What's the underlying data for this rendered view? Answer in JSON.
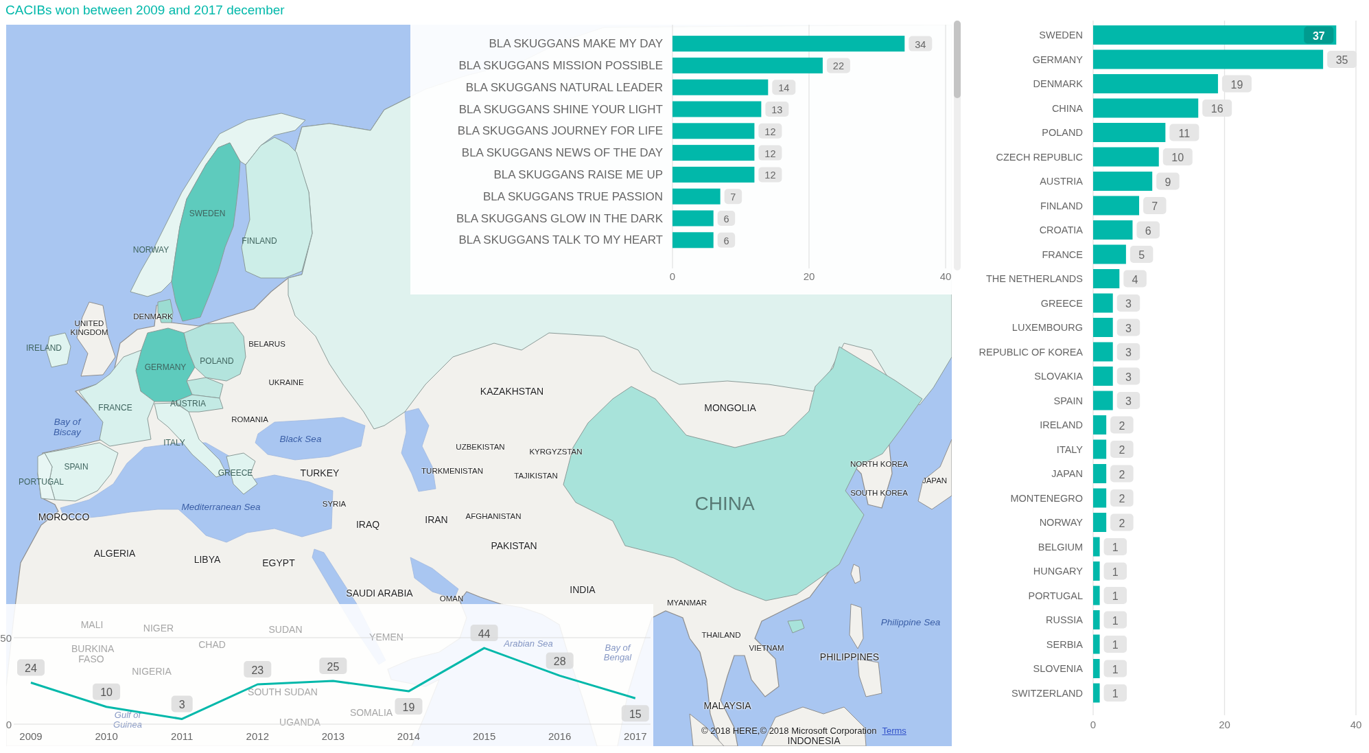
{
  "title": "CACIBs won between 2009 and 2017 december",
  "map": {
    "labels": [
      {
        "text": "SWEDEN",
        "kind": "shaded"
      },
      {
        "text": "FINLAND",
        "kind": "shaded"
      },
      {
        "text": "NORWAY",
        "kind": "shaded"
      },
      {
        "text": "DENMARK",
        "kind": "small"
      },
      {
        "text": "UNITED KINGDOM",
        "kind": "small"
      },
      {
        "text": "IRELAND",
        "kind": "shaded"
      },
      {
        "text": "BELARUS",
        "kind": "small"
      },
      {
        "text": "POLAND",
        "kind": "shaded"
      },
      {
        "text": "GERMANY",
        "kind": "shaded"
      },
      {
        "text": "UKRAINE",
        "kind": "small"
      },
      {
        "text": "KAZAKHSTAN",
        "kind": "country"
      },
      {
        "text": "FRANCE",
        "kind": "shaded"
      },
      {
        "text": "AUSTRIA",
        "kind": "shaded"
      },
      {
        "text": "MONGOLIA",
        "kind": "country"
      },
      {
        "text": "ROMANIA",
        "kind": "small"
      },
      {
        "text": "Bay of Biscay",
        "kind": "sea"
      },
      {
        "text": "ITALY",
        "kind": "shaded"
      },
      {
        "text": "Black Sea",
        "kind": "sea"
      },
      {
        "text": "UZBEKISTAN",
        "kind": "small"
      },
      {
        "text": "KYRGYZSTAN",
        "kind": "small"
      },
      {
        "text": "SPAIN",
        "kind": "shaded"
      },
      {
        "text": "NORTH KOREA",
        "kind": "small"
      },
      {
        "text": "GREECE",
        "kind": "shaded"
      },
      {
        "text": "TURKEY",
        "kind": "country"
      },
      {
        "text": "TURKMENISTAN",
        "kind": "small"
      },
      {
        "text": "TAJIKISTAN",
        "kind": "small"
      },
      {
        "text": "PORTUGAL",
        "kind": "shaded"
      },
      {
        "text": "JAPAN",
        "kind": "small"
      },
      {
        "text": "SOUTH KOREA",
        "kind": "small"
      },
      {
        "text": "Mediterranean Sea",
        "kind": "sea"
      },
      {
        "text": "SYRIA",
        "kind": "small"
      },
      {
        "text": "CHINA",
        "kind": "large"
      },
      {
        "text": "MOROCCO",
        "kind": "country"
      },
      {
        "text": "IRAQ",
        "kind": "country"
      },
      {
        "text": "IRAN",
        "kind": "country"
      },
      {
        "text": "AFGHANISTAN",
        "kind": "small"
      },
      {
        "text": "PAKISTAN",
        "kind": "country"
      },
      {
        "text": "ALGERIA",
        "kind": "country"
      },
      {
        "text": "LIBYA",
        "kind": "country"
      },
      {
        "text": "EGYPT",
        "kind": "country"
      },
      {
        "text": "SAUDI ARABIA",
        "kind": "country"
      },
      {
        "text": "INDIA",
        "kind": "country"
      },
      {
        "text": "OMAN",
        "kind": "small"
      },
      {
        "text": "MYANMAR",
        "kind": "small"
      },
      {
        "text": "Philippine Sea",
        "kind": "sea"
      },
      {
        "text": "THAILAND",
        "kind": "small"
      },
      {
        "text": "VIETNAM",
        "kind": "small"
      },
      {
        "text": "PHILIPPINES",
        "kind": "country"
      },
      {
        "text": "MALAYSIA",
        "kind": "country"
      },
      {
        "text": "INDONESIA",
        "kind": "country"
      }
    ],
    "labels_behind_year_chart": [
      {
        "text": "MALI",
        "kind": "country"
      },
      {
        "text": "NIGER",
        "kind": "country"
      },
      {
        "text": "SUDAN",
        "kind": "country"
      },
      {
        "text": "CHAD",
        "kind": "country"
      },
      {
        "text": "YEMEN",
        "kind": "country"
      },
      {
        "text": "BURKINA FASO",
        "kind": "country"
      },
      {
        "text": "Arabian Sea",
        "kind": "sea"
      },
      {
        "text": "Bay of Bengal",
        "kind": "sea"
      },
      {
        "text": "NIGERIA",
        "kind": "country"
      },
      {
        "text": "SOUTH SUDAN",
        "kind": "country"
      },
      {
        "text": "SOMALIA",
        "kind": "country"
      },
      {
        "text": "Gulf of Guinea",
        "kind": "sea"
      },
      {
        "text": "UGANDA",
        "kind": "country"
      }
    ],
    "attribution": "© 2018 HERE,© 2018 Microsoft Corporation",
    "terms_link": "Terms"
  },
  "name_bar_chart": {
    "chart_data": {
      "type": "bar",
      "orientation": "horizontal",
      "categories": [
        "BLA SKUGGANS MAKE MY DAY",
        "BLA SKUGGANS MISSION POSSIBLE",
        "BLA SKUGGANS NATURAL LEADER",
        "BLA SKUGGANS SHINE YOUR LIGHT",
        "BLA SKUGGANS JOURNEY FOR LIFE",
        "BLA SKUGGANS NEWS OF THE DAY",
        "BLA SKUGGANS RAISE ME UP",
        "BLA SKUGGANS TRUE PASSION",
        "BLA SKUGGANS GLOW IN THE DARK",
        "BLA SKUGGANS TALK TO MY HEART"
      ],
      "series": [
        {
          "color": "#01b8aa",
          "values": [
            34,
            22,
            14,
            13,
            12,
            12,
            12,
            7,
            6,
            6
          ]
        }
      ],
      "xlim": [
        0,
        40
      ],
      "xticks": [
        0,
        20,
        40
      ],
      "data_labels": true
    }
  },
  "country_bar_chart": {
    "chart_data": {
      "type": "bar",
      "orientation": "horizontal",
      "categories": [
        "SWEDEN",
        "GERMANY",
        "DENMARK",
        "CHINA",
        "POLAND",
        "CZECH REPUBLIC",
        "AUSTRIA",
        "FINLAND",
        "CROATIA",
        "FRANCE",
        "THE NETHERLANDS",
        "GREECE",
        "LUXEMBOURG",
        "REPUBLIC OF KOREA",
        "SLOVAKIA",
        "SPAIN",
        "IRELAND",
        "ITALY",
        "JAPAN",
        "MONTENEGRO",
        "NORWAY",
        "BELGIUM",
        "HUNGARY",
        "PORTUGAL",
        "RUSSIA",
        "SERBIA",
        "SLOVENIA",
        "SWITZERLAND"
      ],
      "series": [
        {
          "color": "#01b8aa",
          "values": [
            37,
            35,
            19,
            16,
            11,
            10,
            9,
            7,
            6,
            5,
            4,
            3,
            3,
            3,
            3,
            3,
            2,
            2,
            2,
            2,
            2,
            1,
            1,
            1,
            1,
            1,
            1,
            1
          ]
        }
      ],
      "xlim": [
        0,
        40
      ],
      "xticks": [
        0,
        20,
        40
      ],
      "data_labels": true
    }
  },
  "year_line_chart": {
    "chart_data": {
      "type": "line",
      "categories": [
        "2009",
        "2010",
        "2011",
        "2012",
        "2013",
        "2014",
        "2015",
        "2016",
        "2017"
      ],
      "series": [
        {
          "color": "#01b8aa",
          "values": [
            24,
            10,
            3,
            23,
            25,
            19,
            44,
            28,
            15
          ]
        }
      ],
      "ylim": [
        0,
        50
      ],
      "yticks": [
        0,
        50
      ],
      "data_labels": true
    }
  }
}
